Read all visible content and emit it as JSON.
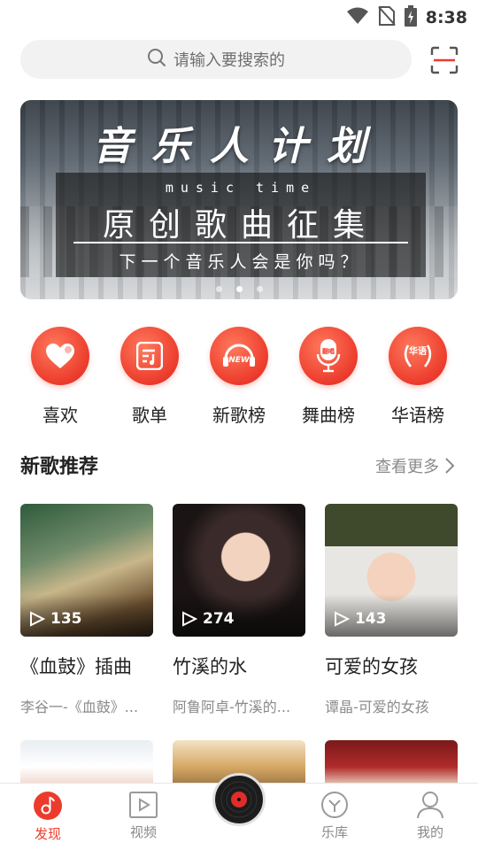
{
  "status_bar": {
    "time": "8:38",
    "icons": [
      "wifi-icon",
      "no-sim-icon",
      "battery-charging-icon"
    ]
  },
  "search": {
    "placeholder": "请输入要搜索的",
    "icon": "search-icon"
  },
  "scan": {
    "icon": "scan-icon"
  },
  "banner": {
    "title": "音乐人计划",
    "subtitle_en": "music      time",
    "main": "原创歌曲征集",
    "question": "下一个音乐人会是你吗？",
    "page_count": 3,
    "active_page": 2
  },
  "categories": [
    {
      "label": "喜欢",
      "icon": "heart-icon"
    },
    {
      "label": "歌单",
      "icon": "playlist-icon"
    },
    {
      "label": "新歌榜",
      "icon": "new-badge-icon",
      "badge_text": "NEW"
    },
    {
      "label": "舞曲榜",
      "icon": "microphone-icon",
      "badge_text": "翻唱"
    },
    {
      "label": "华语榜",
      "icon": "laurel-icon",
      "badge_text": "华语"
    }
  ],
  "section": {
    "title": "新歌推荐",
    "see_more": "查看更多"
  },
  "songs": [
    {
      "title": "《血鼓》插曲",
      "subtitle": "李谷一-《血鼓》...",
      "plays": "135"
    },
    {
      "title": "竹溪的水",
      "subtitle": "阿鲁阿卓-竹溪的...",
      "plays": "274"
    },
    {
      "title": "可爱的女孩",
      "subtitle": "谭晶-可爱的女孩",
      "plays": "143"
    }
  ],
  "bottom_nav": {
    "items": [
      {
        "label": "发现",
        "icon": "music-note-icon",
        "active": true
      },
      {
        "label": "视频",
        "icon": "video-play-icon",
        "active": false
      },
      {
        "label": "",
        "icon": "vinyl-record-icon",
        "active": false
      },
      {
        "label": "乐库",
        "icon": "library-icon",
        "active": false
      },
      {
        "label": "我的",
        "icon": "user-icon",
        "active": false
      }
    ]
  },
  "colors": {
    "accent": "#ec3b2c",
    "muted": "#8a8a8a",
    "search_bg": "#f2f2f2"
  }
}
